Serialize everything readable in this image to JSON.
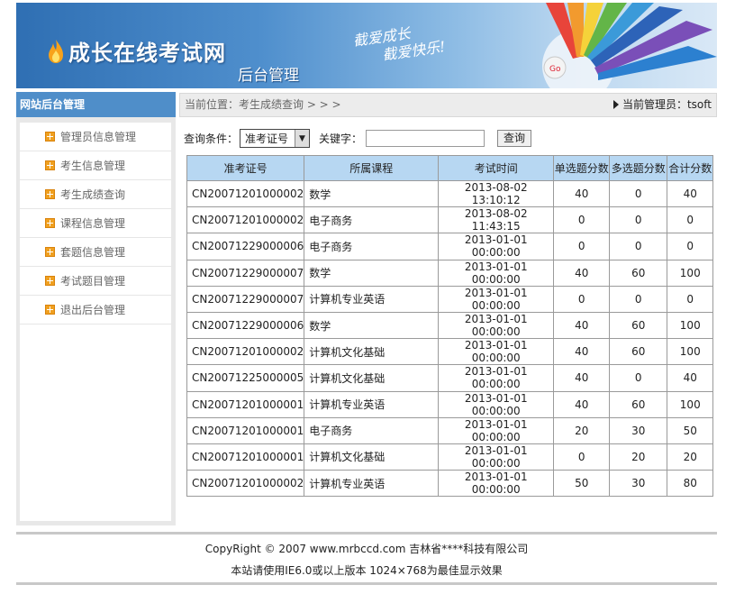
{
  "header": {
    "site_title": "成长在线考试网",
    "sub_title": "后台管理",
    "slogan_line1": "截爱成长",
    "slogan_line2": "截爱快乐!",
    "go_label": "Go"
  },
  "sidebar": {
    "title": "网站后台管理",
    "items": [
      {
        "label": "管理员信息管理"
      },
      {
        "label": "考生信息管理"
      },
      {
        "label": "考生成绩查询"
      },
      {
        "label": "课程信息管理"
      },
      {
        "label": "套题信息管理"
      },
      {
        "label": "考试题目管理"
      },
      {
        "label": "退出后台管理"
      }
    ]
  },
  "breadcrumb": {
    "text": "当前位置：考生成绩查询 > > >",
    "admin": "当前管理员：tsoft"
  },
  "search": {
    "condition_label": "查询条件：",
    "condition_value": "准考证号",
    "keyword_label": "关键字：",
    "keyword_value": "",
    "button_label": "查询"
  },
  "table": {
    "headers": [
      "准考证号",
      "所属课程",
      "考试时间",
      "单选题分数",
      "多选题分数",
      "合计分数"
    ],
    "rows": [
      [
        "CN20071201000002",
        "数学",
        "2013-08-02 13:10:12",
        "40",
        "0",
        "40"
      ],
      [
        "CN20071201000002",
        "电子商务",
        "2013-08-02 11:43:15",
        "0",
        "0",
        "0"
      ],
      [
        "CN20071229000006",
        "电子商务",
        "2013-01-01 00:00:00",
        "0",
        "0",
        "0"
      ],
      [
        "CN20071229000007",
        "数学",
        "2013-01-01 00:00:00",
        "40",
        "60",
        "100"
      ],
      [
        "CN20071229000007",
        "计算机专业英语",
        "2013-01-01 00:00:00",
        "0",
        "0",
        "0"
      ],
      [
        "CN20071229000006",
        "数学",
        "2013-01-01 00:00:00",
        "40",
        "60",
        "100"
      ],
      [
        "CN20071201000002",
        "计算机文化基础",
        "2013-01-01 00:00:00",
        "40",
        "60",
        "100"
      ],
      [
        "CN20071225000005",
        "计算机文化基础",
        "2013-01-01 00:00:00",
        "40",
        "0",
        "40"
      ],
      [
        "CN20071201000001",
        "计算机专业英语",
        "2013-01-01 00:00:00",
        "40",
        "60",
        "100"
      ],
      [
        "CN20071201000001",
        "电子商务",
        "2013-01-01 00:00:00",
        "20",
        "30",
        "50"
      ],
      [
        "CN20071201000001",
        "计算机文化基础",
        "2013-01-01 00:00:00",
        "0",
        "20",
        "20"
      ],
      [
        "CN20071201000002",
        "计算机专业英语",
        "2013-01-01 00:00:00",
        "50",
        "30",
        "80"
      ]
    ]
  },
  "footer": {
    "copyright": "CopyRight © 2007 www.mrbccd.com 吉林省****科技有限公司",
    "note": "本站请使用IE6.0或以上版本 1024×768为最佳显示效果"
  },
  "colors": {
    "banner_blue": "#2f6fb3",
    "sidebar_head": "#4f8ec9",
    "table_header": "#b7d7f2",
    "nav_icon": "#f0a020"
  }
}
